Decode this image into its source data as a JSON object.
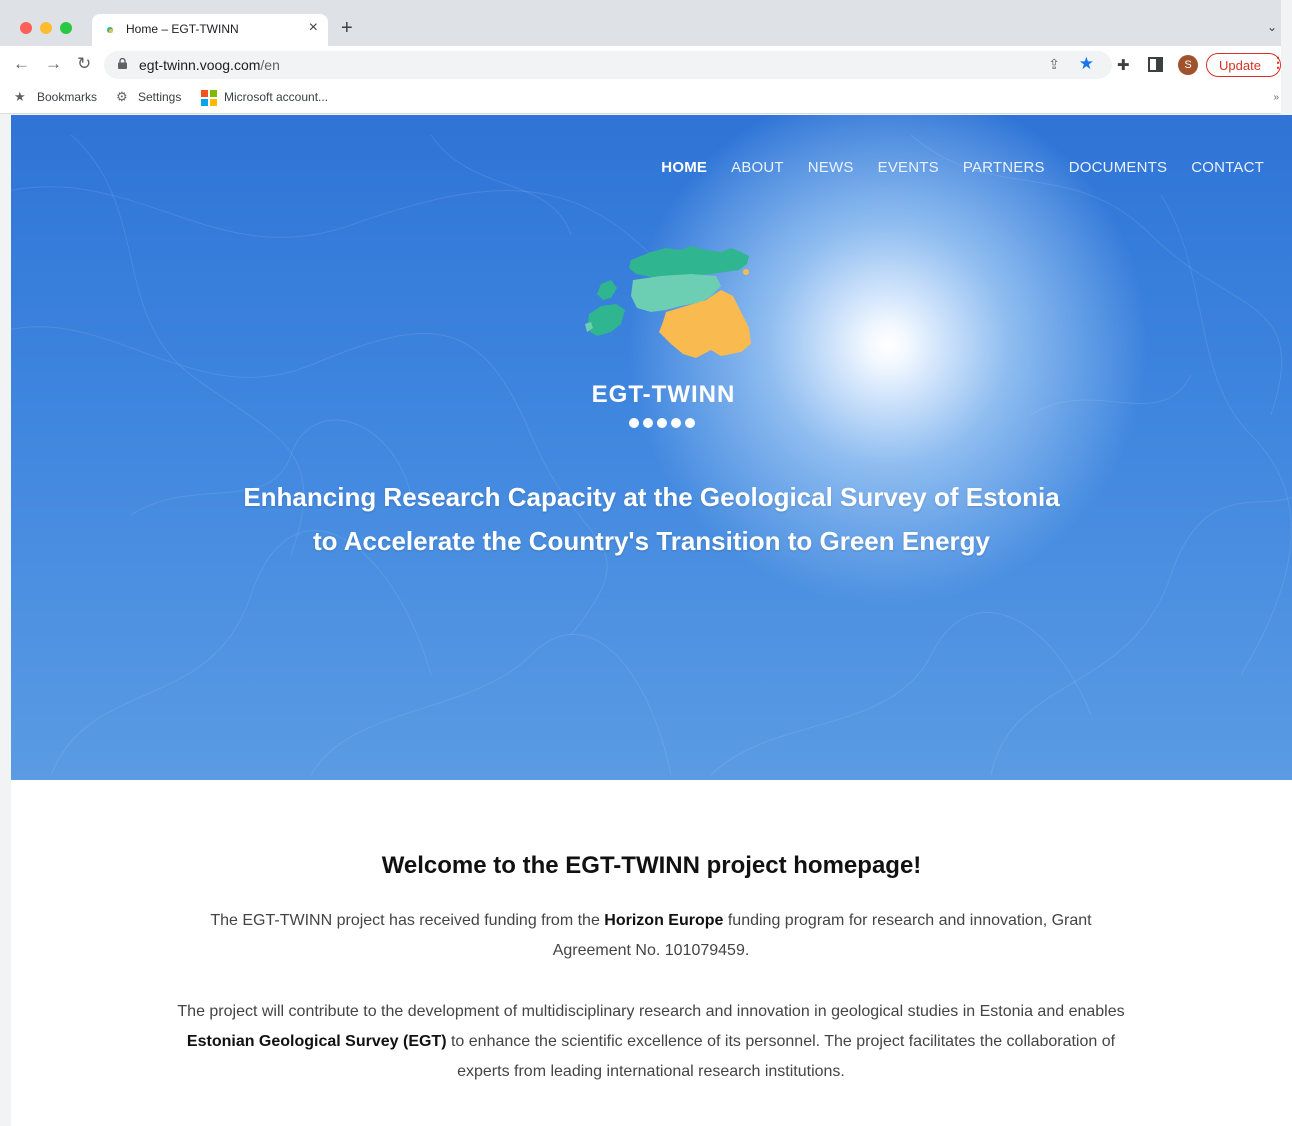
{
  "browser": {
    "tab_title": "Home – EGT-TWINN",
    "url_host": "egt-twinn.voog.com",
    "url_path": "/en",
    "profile_initial": "S",
    "update_label": "Update",
    "bookmarks": [
      {
        "label": "Bookmarks",
        "icon": "star-icon"
      },
      {
        "label": "Settings",
        "icon": "gear-icon"
      },
      {
        "label": "Microsoft account...",
        "icon": "microsoft-logo-icon"
      }
    ]
  },
  "site": {
    "nav": [
      "HOME",
      "ABOUT",
      "NEWS",
      "EVENTS",
      "PARTNERS",
      "DOCUMENTS",
      "CONTACT"
    ],
    "active_nav": "HOME",
    "logo_text": "EGT-TWINN",
    "headline_line1": "Enhancing Research Capacity at the Geological Survey of Estonia",
    "headline_line2": "to Accelerate the Country's Transition to Green Energy",
    "welcome_title": "Welcome to the EGT-TWINN project homepage!",
    "p1_before": "The EGT-TWINN project has received funding from the ",
    "p1_bold": "Horizon Europe",
    "p1_after": " funding program for research and innovation, Grant Agreement No. 101079459.",
    "p2_before": "The project will contribute to the development of multidisciplinary research and innovation in geological studies in Estonia and enables ",
    "p2_bold": "Estonian Geological Survey (EGT)",
    "p2_after": " to enhance the scientific excellence of its personnel. The project facilitates the collaboration of experts from leading international research institutions."
  },
  "colors": {
    "hero_blue": "#2f74d6",
    "map_green_dark": "#2fb58f",
    "map_green_light": "#6ccfb3",
    "map_orange": "#f9bb50",
    "update_red": "#d93025",
    "bookmark_star": "#1a73e8"
  }
}
